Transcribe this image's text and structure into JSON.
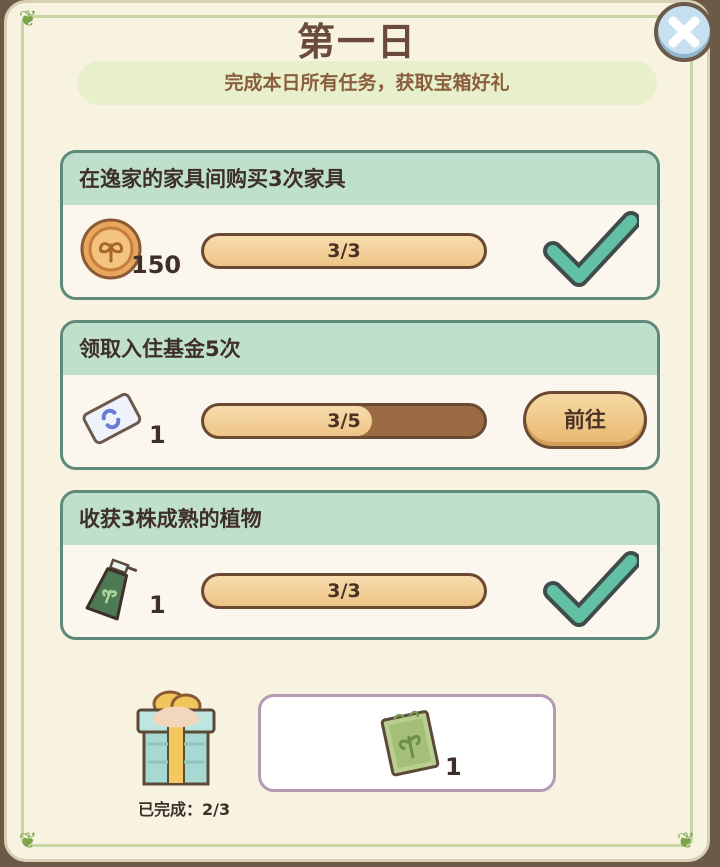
{
  "title": "第一日",
  "subtitle": "完成本日所有任务，获取宝箱好礼",
  "tasks": [
    {
      "name": "在逸家的家具间购买3次家具",
      "reward_count": "150",
      "reward_icon": "coin-icon",
      "progress_text": "3/3",
      "progress": 1.0,
      "status": "completed"
    },
    {
      "name": "领取入住基金5次",
      "reward_count": "1",
      "reward_icon": "ticket-icon",
      "progress_text": "3/5",
      "progress": 0.6,
      "status": "in-progress",
      "button_label": "前往"
    },
    {
      "name": "收获3株成熟的植物",
      "reward_count": "1",
      "reward_icon": "spray-bottle-icon",
      "progress_text": "3/3",
      "progress": 1.0,
      "status": "completed"
    }
  ],
  "chest": {
    "completed_label": "已完成：2/3",
    "reward_count": "1",
    "reward_icon": "seed-packet-icon"
  },
  "colors": {
    "check": "#5fb8a0",
    "task_header": "#bfe0cc",
    "progress_fill": "#f2cf98"
  }
}
